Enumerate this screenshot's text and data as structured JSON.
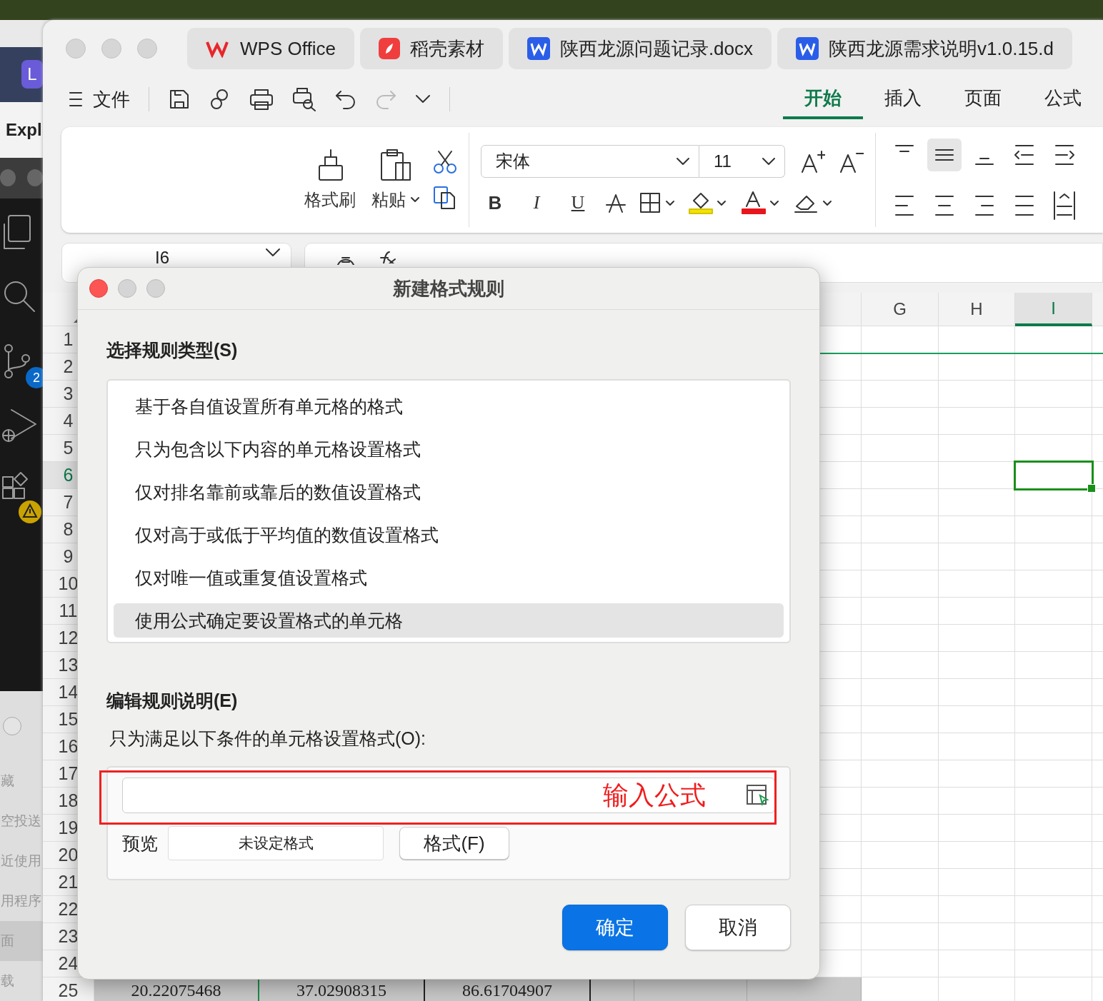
{
  "side_app": {
    "badge": "L",
    "panel_title": "Expl",
    "activity_icons": [
      {
        "kind": "files"
      },
      {
        "kind": "search"
      },
      {
        "kind": "branch",
        "badge": "2"
      },
      {
        "kind": "debug"
      },
      {
        "kind": "extensions",
        "warning": true
      }
    ],
    "finder_items": [
      {
        "label": "藏",
        "selected": false
      },
      {
        "label": "空投送",
        "selected": false
      },
      {
        "label": "近使用",
        "selected": false
      },
      {
        "label": "用程序",
        "selected": false
      },
      {
        "label": "面",
        "selected": true
      },
      {
        "label": "载",
        "selected": false
      }
    ]
  },
  "tabs": [
    {
      "label": "WPS Office",
      "kind": "wps"
    },
    {
      "label": "稻壳素材",
      "kind": "docer"
    },
    {
      "label": "陕西龙源问题记录.docx",
      "kind": "word"
    },
    {
      "label": "陕西龙源需求说明v1.0.15.d",
      "kind": "word"
    }
  ],
  "toolbar": {
    "file_menu": "文件"
  },
  "ribbon_tabs": [
    {
      "label": "开始",
      "selected": true
    },
    {
      "label": "插入",
      "selected": false
    },
    {
      "label": "页面",
      "selected": false
    },
    {
      "label": "公式",
      "selected": false
    }
  ],
  "ribbon": {
    "format_painter": "格式刷",
    "paste": "粘贴",
    "font": "宋体",
    "font_size": "11",
    "style_buttons": [
      {
        "label": "B",
        "kind": "bold"
      },
      {
        "label": "I",
        "kind": "italic"
      },
      {
        "label": "U",
        "kind": "underline"
      }
    ]
  },
  "name_box": "I6",
  "sheet": {
    "columns": [
      {
        "label": "G",
        "selected": false
      },
      {
        "label": "H",
        "selected": false
      },
      {
        "label": "I",
        "selected": true
      }
    ],
    "rows": [
      {
        "label": "1",
        "selected": false
      },
      {
        "label": "2",
        "selected": false
      },
      {
        "label": "3",
        "selected": false
      },
      {
        "label": "4",
        "selected": false
      },
      {
        "label": "5",
        "selected": false
      },
      {
        "label": "6",
        "selected": true
      },
      {
        "label": "7",
        "selected": false
      },
      {
        "label": "8",
        "selected": false
      },
      {
        "label": "9",
        "selected": false
      },
      {
        "label": "10",
        "selected": false
      },
      {
        "label": "11",
        "selected": false
      },
      {
        "label": "12",
        "selected": false
      },
      {
        "label": "13",
        "selected": false
      },
      {
        "label": "14",
        "selected": false
      },
      {
        "label": "15",
        "selected": false
      },
      {
        "label": "16",
        "selected": false
      },
      {
        "label": "17",
        "selected": false
      },
      {
        "label": "18",
        "selected": false
      },
      {
        "label": "19",
        "selected": false
      },
      {
        "label": "20",
        "selected": false
      },
      {
        "label": "21",
        "selected": false
      },
      {
        "label": "22",
        "selected": false
      },
      {
        "label": "23",
        "selected": false
      },
      {
        "label": "24",
        "selected": false
      },
      {
        "label": "25",
        "selected": false,
        "cells": [
          "20.22075468",
          "37.02908315",
          "86.61704907"
        ]
      }
    ]
  },
  "dialog": {
    "title": "新建格式规则",
    "rule_type_heading": "选择规则类型(S)",
    "rule_types": [
      {
        "label": "基于各自值设置所有单元格的格式",
        "selected": false
      },
      {
        "label": "只为包含以下内容的单元格设置格式",
        "selected": false
      },
      {
        "label": "仅对排名靠前或靠后的数值设置格式",
        "selected": false
      },
      {
        "label": "仅对高于或低于平均值的数值设置格式",
        "selected": false
      },
      {
        "label": "仅对唯一值或重复值设置格式",
        "selected": false
      },
      {
        "label": "使用公式确定要设置格式的单元格",
        "selected": true
      }
    ],
    "description_heading": "编辑规则说明(E)",
    "condition_label": "只为满足以下条件的单元格设置格式(O):",
    "annotation": "输入公式",
    "preview_label": "预览",
    "preview_text": "未设定格式",
    "format_button": "格式(F)",
    "buttons": [
      {
        "label": "确定",
        "kind": "primary"
      },
      {
        "label": "取消",
        "kind": "secondary"
      }
    ]
  }
}
